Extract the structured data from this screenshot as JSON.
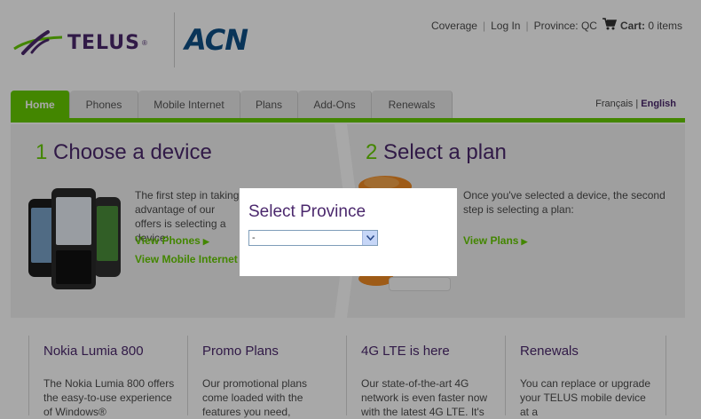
{
  "header": {
    "telus_logo": "TELUS",
    "acn_logo": "ACN",
    "links": {
      "coverage": "Coverage",
      "login": "Log In",
      "province": "Province: QC",
      "cart_label": "Cart:",
      "cart_count": "0 items"
    }
  },
  "nav": {
    "tabs": [
      {
        "label": "Home"
      },
      {
        "label": "Phones"
      },
      {
        "label": "Mobile Internet"
      },
      {
        "label": "Plans"
      },
      {
        "label": "Add-Ons"
      },
      {
        "label": "Renewals"
      }
    ],
    "lang_fr": "Français",
    "lang_sep": "|",
    "lang_en": "English"
  },
  "hero": {
    "step1": {
      "num": "1",
      "title": "Choose a device",
      "text": "The first step in taking advantage of our offers is selecting a device:",
      "link1": "View Phones",
      "link2": "View Mobile Internet"
    },
    "step2": {
      "num": "2",
      "title": "Select a plan",
      "text": "Once you've selected a device, the second step is selecting a plan:",
      "link1": "View Plans"
    }
  },
  "cards": [
    {
      "title": "Nokia Lumia 800",
      "text": "The Nokia Lumia 800 offers the easy-to-use experience of Windows®"
    },
    {
      "title": "Promo Plans",
      "text": "Our promotional plans come loaded with the features you need,"
    },
    {
      "title": "4G LTE is here",
      "text": "Our state-of-the-art 4G network is even faster now with the latest 4G LTE. It's"
    },
    {
      "title": "Renewals",
      "text": "You can replace or upgrade your TELUS mobile device at a"
    }
  ],
  "modal": {
    "title": "Select Province",
    "select_value": "-"
  },
  "colors": {
    "telus_purple": "#4b286d",
    "telus_green": "#66cc00",
    "acn_blue": "#0f4f86"
  }
}
